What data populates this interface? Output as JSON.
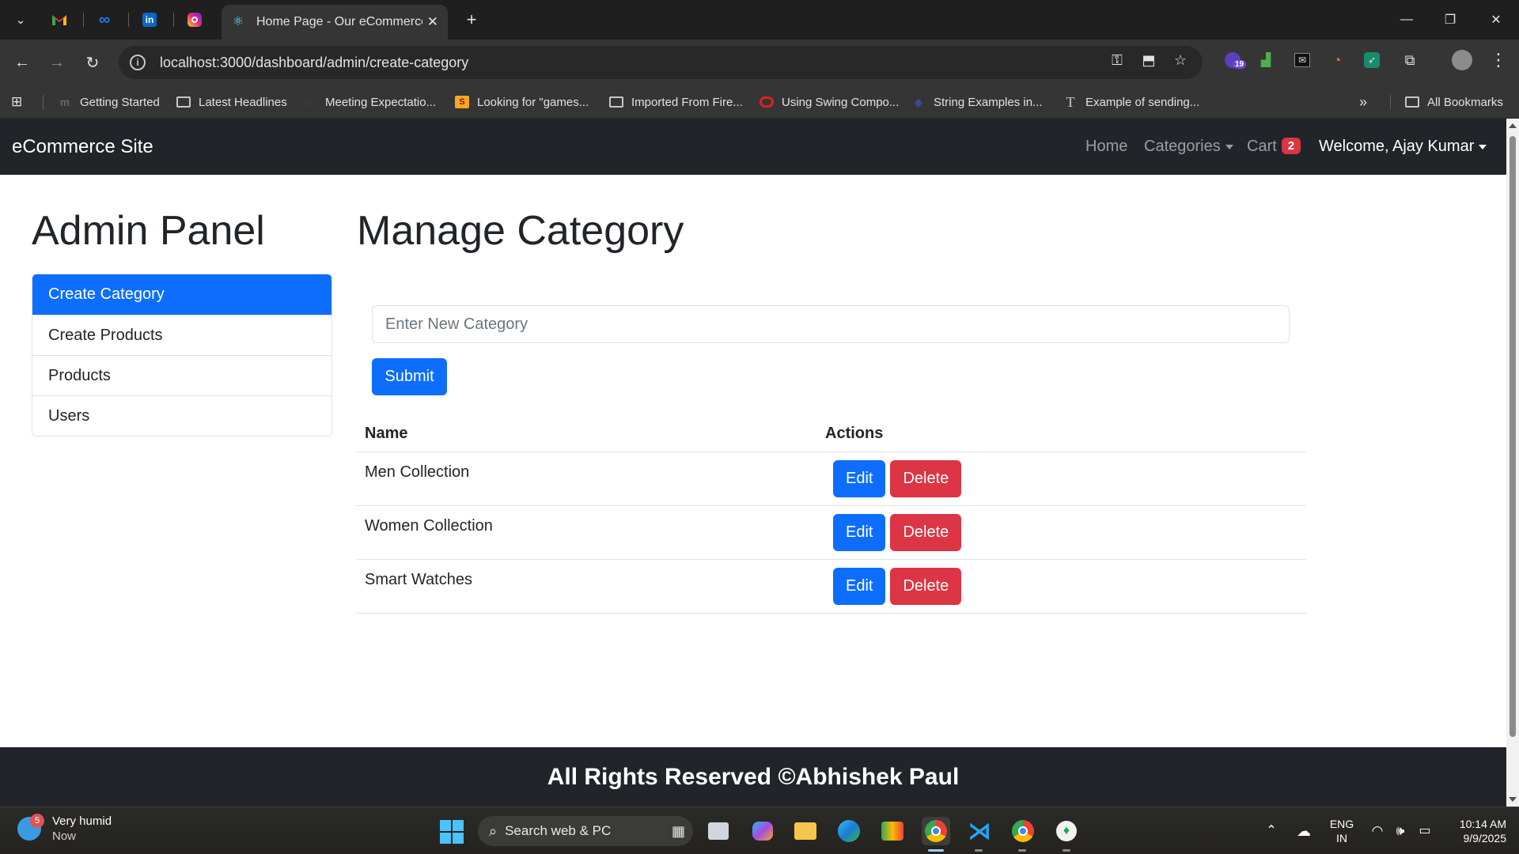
{
  "browser": {
    "tab_title": "Home Page - Our eCommerce S",
    "url": "localhost:3000/dashboard/admin/create-category",
    "bookmarks": [
      {
        "label": "Getting Started"
      },
      {
        "label": "Latest Headlines"
      },
      {
        "label": "Meeting Expectatio..."
      },
      {
        "label": "Looking for \"games..."
      },
      {
        "label": "Imported From Fire..."
      },
      {
        "label": "Using Swing Compo..."
      },
      {
        "label": "String Examples in..."
      },
      {
        "label": "Example of sending..."
      }
    ],
    "all_bookmarks_label": "All Bookmarks",
    "ext_badge": "19"
  },
  "navbar": {
    "brand": "eCommerce Site",
    "home": "Home",
    "categories": "Categories",
    "cart": "Cart",
    "cart_count": "2",
    "welcome": "Welcome, Ajay Kumar"
  },
  "sidebar": {
    "title": "Admin Panel",
    "items": [
      {
        "label": "Create Category"
      },
      {
        "label": "Create Products"
      },
      {
        "label": "Products"
      },
      {
        "label": "Users"
      }
    ]
  },
  "main": {
    "title": "Manage Category",
    "input_placeholder": "Enter New Category",
    "input_value": "",
    "submit_label": "Submit",
    "table": {
      "headers": [
        "Name",
        "Actions"
      ],
      "rows": [
        {
          "name": "Men Collection"
        },
        {
          "name": "Women Collection"
        },
        {
          "name": "Smart Watches"
        }
      ],
      "edit_label": "Edit",
      "delete_label": "Delete"
    }
  },
  "footer": {
    "text": "All Rights Reserved ©Abhishek Paul"
  },
  "taskbar": {
    "weather_badge": "5",
    "weather_title": "Very humid",
    "weather_sub": "Now",
    "search_placeholder": "Search web & PC",
    "lang_top": "ENG",
    "lang_bottom": "IN",
    "time": "10:14 AM",
    "date": "9/9/2025"
  },
  "colors": {
    "primary": "#0d6efd",
    "danger": "#dc3545",
    "navbar_bg": "#212529",
    "chrome_bg": "#1f1f1f",
    "toolbar_bg": "#353535"
  }
}
